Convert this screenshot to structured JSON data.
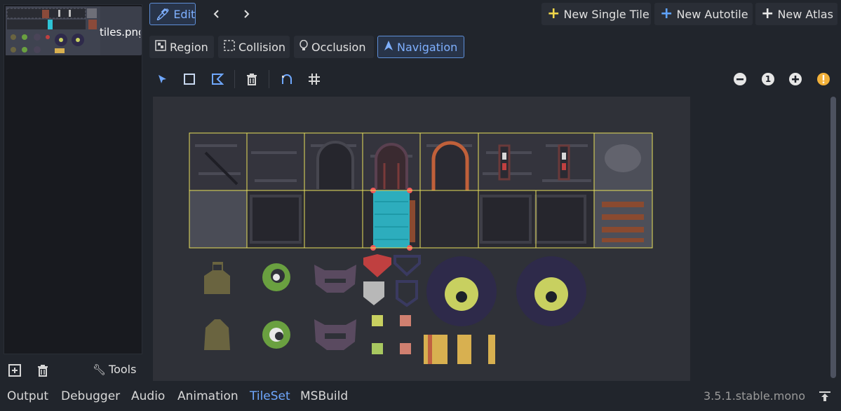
{
  "left_panel": {
    "texture_name": "tiles.png",
    "tools_label": "Tools"
  },
  "toolbar": {
    "edit_label": "Edit",
    "new_single_tile": "New Single Tile",
    "new_autotile": "New Autotile",
    "new_atlas": "New Atlas"
  },
  "modes": {
    "region": "Region",
    "collision": "Collision",
    "occlusion": "Occlusion",
    "navigation": "Navigation"
  },
  "zoom": {
    "reset_label": "1"
  },
  "bottom_tabs": [
    "Output",
    "Debugger",
    "Audio",
    "Animation",
    "TileSet",
    "MSBuild"
  ],
  "active_bottom_tab": "TileSet",
  "version": "3.5.1.stable.mono",
  "colors": {
    "accent": "#5e8fd8",
    "grid": "#e8e05a",
    "navigation_poly": "#2ec4d6",
    "handle": "#f05a5a"
  }
}
